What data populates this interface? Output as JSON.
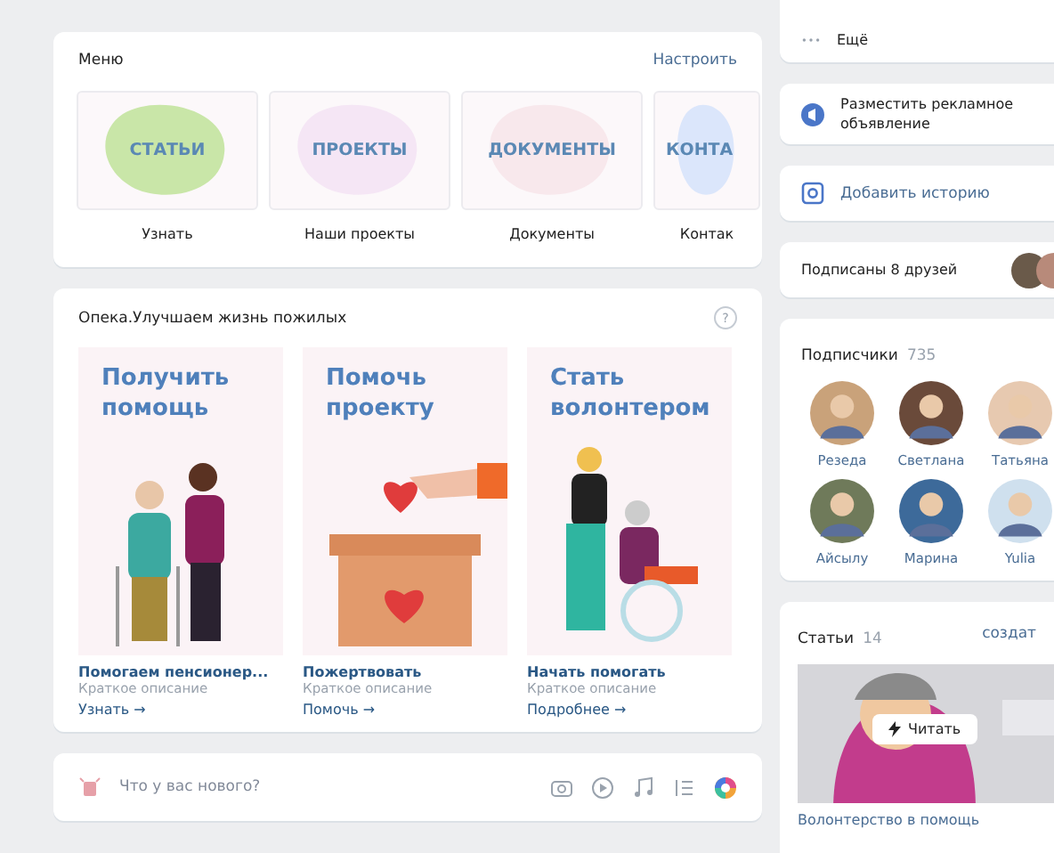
{
  "menu": {
    "title": "Меню",
    "action": "Настроить",
    "items": [
      {
        "tile_text": "СТАТЬИ",
        "label": "Узнать",
        "color": "#c9e6a8"
      },
      {
        "tile_text": "ПРОЕКТЫ",
        "label": "Наши проекты",
        "color": "#f5e6f5"
      },
      {
        "tile_text": "ДОКУМЕНТЫ",
        "label": "Документы",
        "color": "#f8e8ec"
      },
      {
        "tile_text": "КОНТА",
        "label": "Контак",
        "color": "#dbe6fb"
      }
    ]
  },
  "widget": {
    "title": "Опека.Улучшаем жизнь пожилых",
    "help": "?",
    "cards": [
      {
        "kind": "elders",
        "heading": "Получить помощь",
        "title": "Помогаем пенсионер...",
        "description": "Краткое описание",
        "link": "Узнать →"
      },
      {
        "kind": "donation",
        "heading": "Помочь проекту",
        "title": "Пожертвовать",
        "description": "Краткое описание",
        "link": "Помочь →"
      },
      {
        "kind": "wheelchair",
        "heading": "Стать волонтером",
        "title": "Начать помогать",
        "description": "Краткое описание",
        "link": "Подробнее →"
      }
    ]
  },
  "composer": {
    "placeholder": "Что у вас нового?"
  },
  "sidebar": {
    "more": "Ещё",
    "ad": "Разместить рекламное объявление",
    "story": "Добавить историю",
    "friends": "Подписаны 8 друзей",
    "followers": {
      "title": "Подписчики",
      "count": "735",
      "people": [
        {
          "name": "Резеда"
        },
        {
          "name": "Светлана"
        },
        {
          "name": "Татьяна"
        },
        {
          "name": "Айсылу"
        },
        {
          "name": "Марина"
        },
        {
          "name": "Yulia"
        }
      ]
    },
    "articles": {
      "title": "Статьи",
      "count": "14",
      "action": "создат",
      "button": "Читать",
      "caption": "Волонтерство в помощь"
    }
  }
}
